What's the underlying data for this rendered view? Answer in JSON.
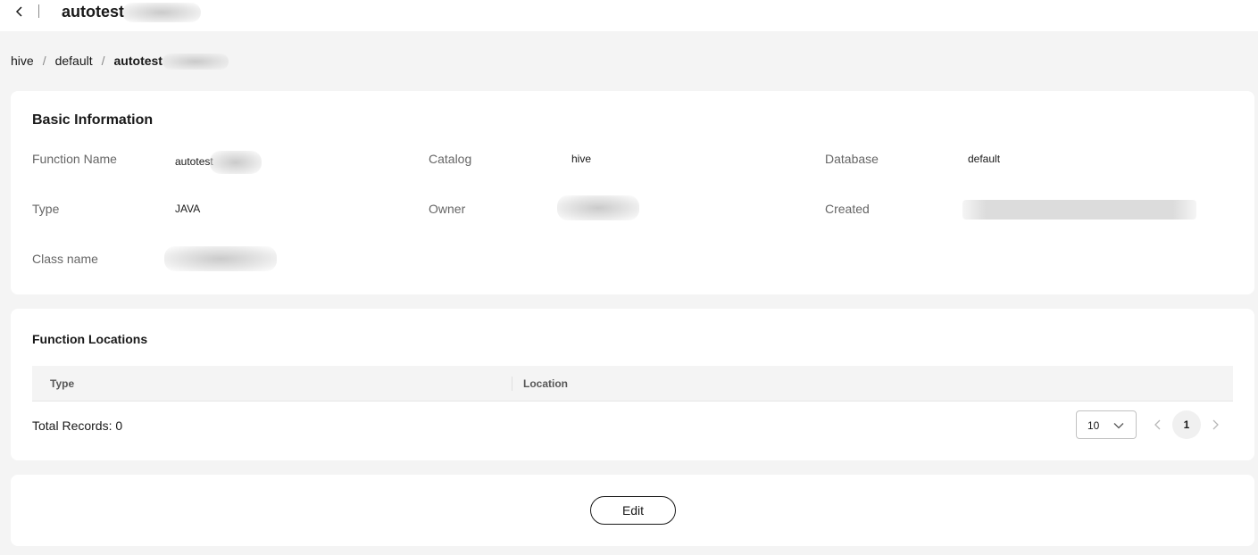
{
  "header": {
    "back_icon": "chevron-left-icon",
    "title": "autotest"
  },
  "breadcrumb": {
    "items": [
      "hive",
      "default"
    ],
    "separator": "/",
    "current": "autotest"
  },
  "basic_info": {
    "title": "Basic Information",
    "fields": {
      "function_name": {
        "label": "Function Name",
        "value": "autotest"
      },
      "catalog": {
        "label": "Catalog",
        "value": "hive"
      },
      "database": {
        "label": "Database",
        "value": "default"
      },
      "type": {
        "label": "Type",
        "value": "JAVA"
      },
      "owner": {
        "label": "Owner"
      },
      "created": {
        "label": "Created"
      },
      "class_name": {
        "label": "Class name"
      }
    }
  },
  "function_locations": {
    "title": "Function Locations",
    "columns": [
      "Type",
      "Location"
    ],
    "rows": [],
    "total_records_label": "Total Records: 0",
    "page_size": "10",
    "current_page": "1"
  },
  "actions": {
    "edit_label": "Edit"
  },
  "colors": {
    "background": "#f4f4f4",
    "card": "#ffffff",
    "text": "#191919",
    "label": "#666666"
  }
}
